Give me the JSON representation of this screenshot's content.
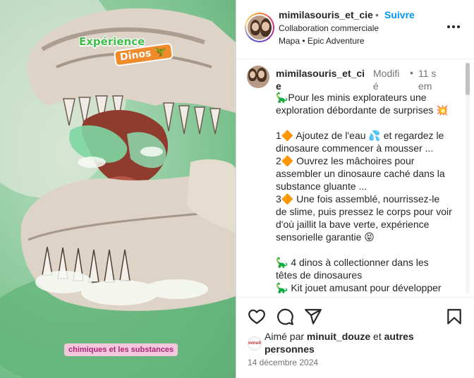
{
  "media": {
    "sticker_experience": "Expérience",
    "sticker_dinos": "Dinos",
    "sticker_caption": "chimiques et les substances"
  },
  "header": {
    "username": "mimilasouris_et_cie",
    "separator": "•",
    "follow_label": "Suivre",
    "subtitle": "Collaboration commerciale",
    "collab_line": "Mapa • Epic Adventure",
    "more_icon": "more-horizontal-icon"
  },
  "caption": {
    "username": "mimilasouris_et_cie",
    "edited_label": "Modifié",
    "separator": "•",
    "time": "11 sem",
    "lines": [
      "🦕Pour les minis explorateurs une exploration débordante de surprises 💥",
      "",
      "1🔶 Ajoutez de l'eau 💦 et regardez le dinosaure commencer à mousser ...",
      "2🔶 Ouvrez les mâchoires pour assembler un dinosaure caché dans la substance gluante ...",
      "3🔶 Une fois assemblé, nourrissez-le de slime, puis pressez le corps pour voir d'où jaillit la bave verte, expérience sensorielle garantie 😝",
      "",
      "🦕 4 dinos à collectionner dans les têtes de dinosaures",
      "🦕 Kit jouet amusant pour développer"
    ]
  },
  "actions": {
    "like_icon": "heart-icon",
    "comment_icon": "comment-icon",
    "share_icon": "share-icon",
    "save_icon": "bookmark-icon"
  },
  "likes": {
    "prefix": "Aimé par ",
    "user": "minuit_douze",
    "middle": " et ",
    "rest": "autres personnes",
    "avatar_text": "minuit"
  },
  "date": "14 décembre 2024",
  "colors": {
    "accent": "#0095f6",
    "text": "#262626",
    "muted": "#737373",
    "slime_green": "#6cbb83"
  }
}
